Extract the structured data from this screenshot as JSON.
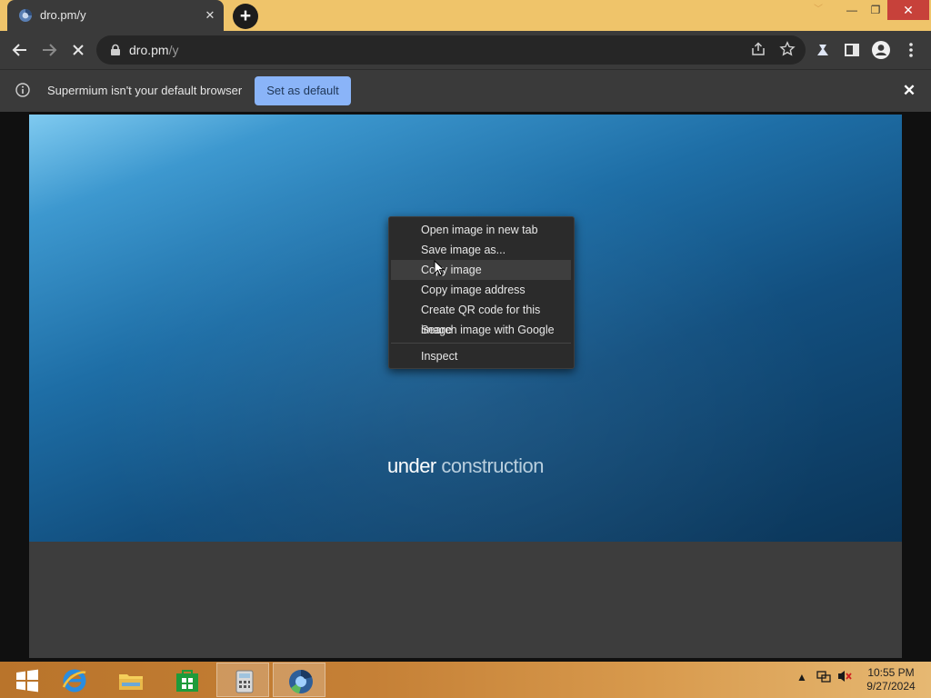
{
  "browser": {
    "tab": {
      "title": "dro.pm/y",
      "close_glyph": "✕"
    },
    "new_tab_glyph": "+",
    "window_controls": {
      "minimize": "—",
      "restore": "❐",
      "close": "✕"
    },
    "address": {
      "host": "dro.pm",
      "path": "/y"
    },
    "infobar": {
      "message": "Supermium isn't your default browser",
      "button_label": "Set as default",
      "close_glyph": "✕"
    }
  },
  "page": {
    "caption": {
      "strong": "under",
      "light": "construction"
    }
  },
  "context_menu": {
    "items": [
      "Open image in new tab",
      "Save image as...",
      "Copy image",
      "Copy image address",
      "Create QR code for this image",
      "Search image with Google"
    ],
    "highlighted_index": 2,
    "inspect": "Inspect"
  },
  "taskbar": {
    "apps": [
      "start-icon",
      "internet-explorer-icon",
      "file-explorer-icon",
      "store-icon",
      "calculator-icon",
      "supermium-icon"
    ],
    "active_app": "supermium-icon",
    "clock": {
      "time": "10:55 PM",
      "date": "9/27/2024"
    }
  },
  "colors": {
    "accent_button": "#8ab4f8",
    "taskbar": "#c58036",
    "titlebar": "#efc46a",
    "close_button": "#c7413a"
  }
}
